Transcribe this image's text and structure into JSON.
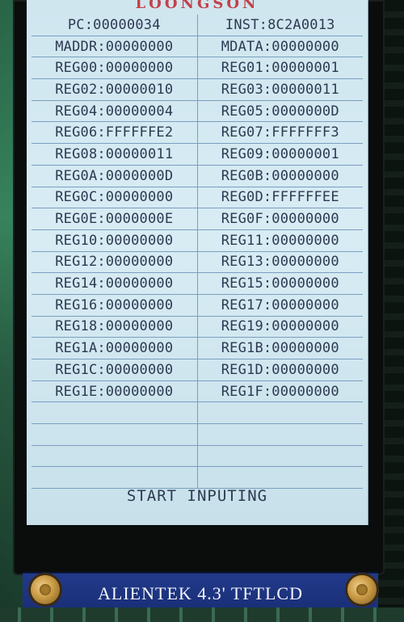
{
  "banner": "LOONGSON",
  "registers": [
    [
      "PC:00000034",
      "INST:8C2A0013"
    ],
    [
      "MADDR:00000000",
      "MDATA:00000000"
    ],
    [
      "REG00:00000000",
      "REG01:00000001"
    ],
    [
      "REG02:00000010",
      "REG03:00000011"
    ],
    [
      "REG04:00000004",
      "REG05:0000000D"
    ],
    [
      "REG06:FFFFFFE2",
      "REG07:FFFFFFF3"
    ],
    [
      "REG08:00000011",
      "REG09:00000001"
    ],
    [
      "REG0A:0000000D",
      "REG0B:00000000"
    ],
    [
      "REG0C:00000000",
      "REG0D:FFFFFFEE"
    ],
    [
      "REG0E:0000000E",
      "REG0F:00000000"
    ],
    [
      "REG10:00000000",
      "REG11:00000000"
    ],
    [
      "REG12:00000000",
      "REG13:00000000"
    ],
    [
      "REG14:00000000",
      "REG15:00000000"
    ],
    [
      "REG16:00000000",
      "REG17:00000000"
    ],
    [
      "REG18:00000000",
      "REG19:00000000"
    ],
    [
      "REG1A:00000000",
      "REG1B:00000000"
    ],
    [
      "REG1C:00000000",
      "REG1D:00000000"
    ],
    [
      "REG1E:00000000",
      "REG1F:00000000"
    ]
  ],
  "status": "START INPUTING",
  "board_label": "ALIENTEK 4.3' TFTLCD"
}
